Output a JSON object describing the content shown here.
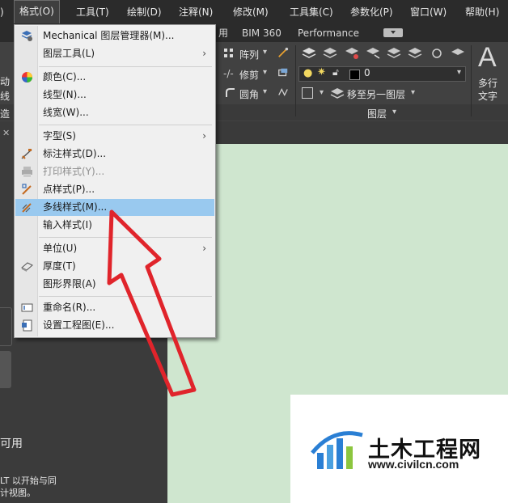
{
  "menubar": {
    "items": [
      {
        "label": ")"
      },
      {
        "label": "格式(O)"
      },
      {
        "label": "工具(T)"
      },
      {
        "label": "绘制(D)"
      },
      {
        "label": "注释(N)"
      },
      {
        "label": "修改(M)"
      },
      {
        "label": "工具集(C)"
      },
      {
        "label": "参数化(P)"
      },
      {
        "label": "窗口(W)"
      },
      {
        "label": "帮助(H)"
      }
    ]
  },
  "tabs": [
    {
      "label": "用"
    },
    {
      "label": "BIM 360"
    },
    {
      "label": "Performance"
    }
  ],
  "ribbon": {
    "array_label": "阵列",
    "trim_label": "修剪",
    "fillet_label": "圆角",
    "layer_value": "0",
    "move_to_layer_label": "移至另一图层",
    "layers_panel_label": "图层",
    "multiline_text_label_1": "多行",
    "multiline_text_label_2": "文字",
    "text_icon_glyph": "A"
  },
  "left_fragments": {
    "f1": "动",
    "f2": "线",
    "f3": "造",
    "f4": "可用",
    "f5": "LT 以开始与同",
    "f6": "计视图。"
  },
  "format_menu": {
    "items": [
      {
        "label": "Mechanical 图层管理器(M)...",
        "icon": "layer-manager-icon",
        "submenu": false,
        "disabled": false,
        "highlighted": false
      },
      {
        "label": "图层工具(L)",
        "icon": "",
        "submenu": true,
        "disabled": false,
        "highlighted": false
      },
      {
        "label": "颜色(C)...",
        "icon": "color-wheel-icon",
        "submenu": false,
        "disabled": false,
        "highlighted": false
      },
      {
        "label": "线型(N)...",
        "icon": "",
        "submenu": false,
        "disabled": false,
        "highlighted": false
      },
      {
        "label": "线宽(W)...",
        "icon": "",
        "submenu": false,
        "disabled": false,
        "highlighted": false
      },
      {
        "label": "字型(S)",
        "icon": "",
        "submenu": true,
        "disabled": false,
        "highlighted": false
      },
      {
        "label": "标注样式(D)...",
        "icon": "dimension-style-icon",
        "submenu": false,
        "disabled": false,
        "highlighted": false
      },
      {
        "label": "打印样式(Y)...",
        "icon": "print-style-icon",
        "submenu": false,
        "disabled": true,
        "highlighted": false
      },
      {
        "label": "点样式(P)...",
        "icon": "point-style-icon",
        "submenu": false,
        "disabled": false,
        "highlighted": false
      },
      {
        "label": "多线样式(M)...",
        "icon": "multiline-style-icon",
        "submenu": false,
        "disabled": false,
        "highlighted": true
      },
      {
        "label": "输入样式(I)",
        "icon": "",
        "submenu": false,
        "disabled": false,
        "highlighted": false
      },
      {
        "label": "单位(U)",
        "icon": "",
        "submenu": true,
        "disabled": false,
        "highlighted": false
      },
      {
        "label": "厚度(T)",
        "icon": "thickness-icon",
        "submenu": false,
        "disabled": false,
        "highlighted": false
      },
      {
        "label": "图形界限(A)",
        "icon": "",
        "submenu": false,
        "disabled": false,
        "highlighted": false
      },
      {
        "label": "重命名(R)...",
        "icon": "rename-icon",
        "submenu": false,
        "disabled": false,
        "highlighted": false
      },
      {
        "label": "设置工程图(E)...",
        "icon": "drawing-setup-icon",
        "submenu": false,
        "disabled": false,
        "highlighted": false
      }
    ]
  },
  "watermark": {
    "title": "土木工程网",
    "url": "www.civilcn.com"
  },
  "colors": {
    "highlight": "#99c9ef",
    "annotation_arrow": "#e0242b",
    "canvas": "#cfe6cf"
  }
}
